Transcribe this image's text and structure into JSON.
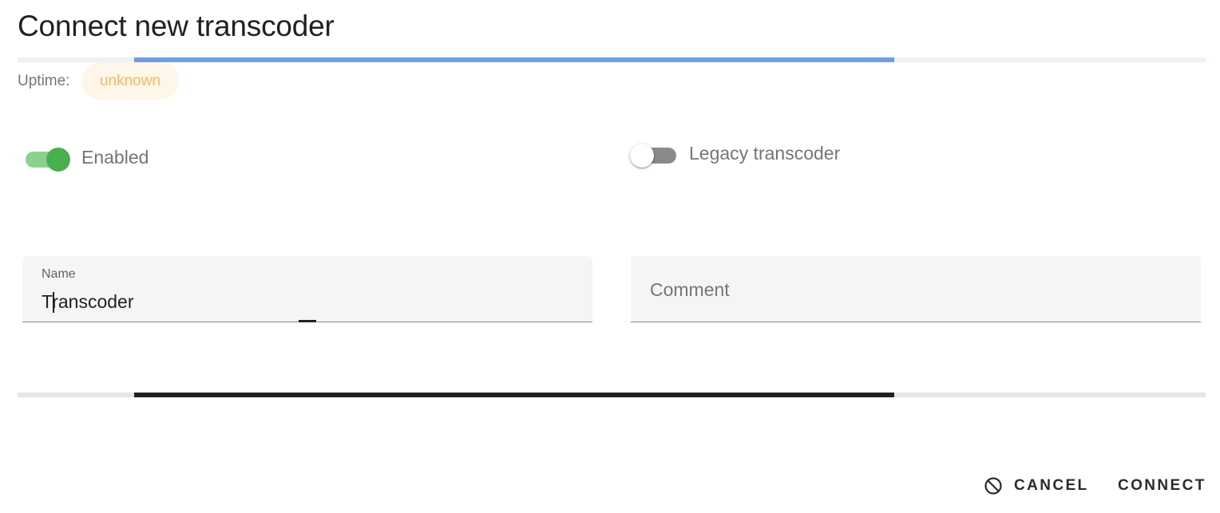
{
  "dialog": {
    "title": "Connect new transcoder"
  },
  "uptime": {
    "label": "Uptime:",
    "value": "unknown",
    "chip_color": "#f5b75f"
  },
  "progress": {
    "indeterminate": true,
    "top_color": "#6f9fe0",
    "bottom_color": "#212121"
  },
  "switches": {
    "enabled": {
      "label": "Enabled",
      "checked": true,
      "color": "#48b04a"
    },
    "legacy": {
      "label": "Legacy transcoder",
      "checked": false
    }
  },
  "fields": {
    "name": {
      "label": "Name",
      "value": "Transcoder"
    },
    "comment": {
      "placeholder": "Comment",
      "value": ""
    }
  },
  "actions": {
    "cancel": {
      "label": "Cancel",
      "icon": "cancel-icon"
    },
    "connect": {
      "label": "Connect"
    }
  }
}
